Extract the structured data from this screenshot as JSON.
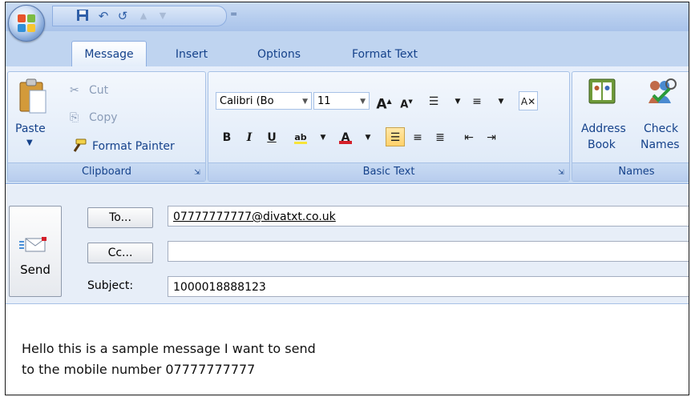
{
  "quick_access": {
    "icons": [
      "save-icon",
      "undo-icon",
      "redo-icon",
      "up-arrow-icon",
      "down-arrow-icon",
      "customize-icon"
    ],
    "customize_glyph": "="
  },
  "tabs": [
    {
      "label": "Message",
      "active": true
    },
    {
      "label": "Insert",
      "active": false
    },
    {
      "label": "Options",
      "active": false
    },
    {
      "label": "Format Text",
      "active": false
    }
  ],
  "clipboard": {
    "paste_label": "Paste",
    "cut_label": "Cut",
    "copy_label": "Copy",
    "format_painter_label": "Format Painter",
    "group_label": "Clipboard"
  },
  "basic_text": {
    "font_name": "Calibri (Bo",
    "font_size": "11",
    "group_label": "Basic Text",
    "bold": "B",
    "italic": "I",
    "underline": "U"
  },
  "names": {
    "address_book_label1": "Address",
    "address_book_label2": "Book",
    "check_names_label1": "Check",
    "check_names_label2": "Names",
    "group_label": "Names"
  },
  "send": {
    "label": "Send"
  },
  "header": {
    "to_button": "To...",
    "cc_button": "Cc...",
    "subject_label": "Subject:",
    "to_value": "07777777777@divatxt.co.uk",
    "cc_value": "",
    "subject_value": "1000018888123"
  },
  "body": {
    "line1": "Hello this is a sample message I want to send",
    "line2": "to the mobile number 07777777777"
  },
  "colors": {
    "ribbon_text": "#15428b",
    "highlight": "#ffd26a",
    "accent_red": "#d4202a"
  }
}
